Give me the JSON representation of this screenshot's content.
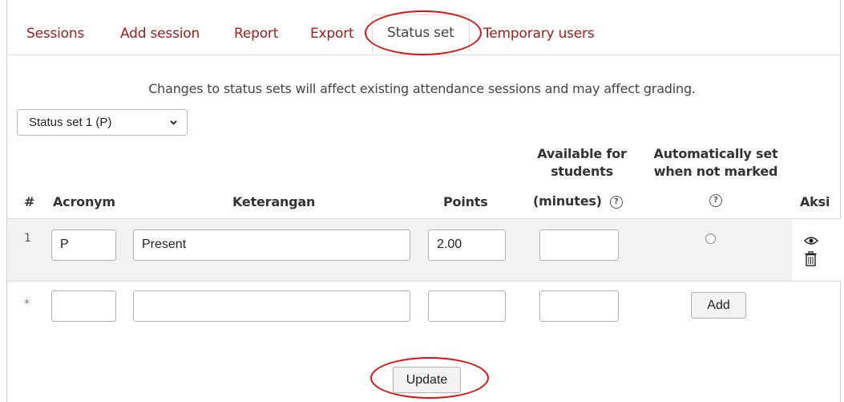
{
  "tabs": [
    {
      "label": "Sessions",
      "active": false
    },
    {
      "label": "Add session",
      "active": false
    },
    {
      "label": "Report",
      "active": false
    },
    {
      "label": "Export",
      "active": false
    },
    {
      "label": "Status set",
      "active": true
    },
    {
      "label": "Temporary users",
      "active": false
    }
  ],
  "notice": "Changes to status sets will affect existing attendance sessions and may affect grading.",
  "status_set_select": {
    "selected": "Status set 1 (P)"
  },
  "table": {
    "headers": {
      "num": "#",
      "acronym": "Acronym",
      "keterangan": "Keterangan",
      "points": "Points",
      "available_line1": "Available for",
      "available_line2": "students",
      "available_line3": "(minutes)",
      "auto_line1": "Automatically set",
      "auto_line2": "when not marked",
      "aksi": "Aksi"
    },
    "rows": [
      {
        "num": "1",
        "acronym": "P",
        "keterangan": "Present",
        "points": "2.00",
        "available": "",
        "auto_selected": false
      }
    ],
    "new_row": {
      "num": "*",
      "acronym": "",
      "keterangan": "",
      "points": "",
      "available": "",
      "add_label": "Add"
    }
  },
  "update_label": "Update",
  "colors": {
    "accent": "#a51c1c",
    "annotation": "#dd1111"
  }
}
